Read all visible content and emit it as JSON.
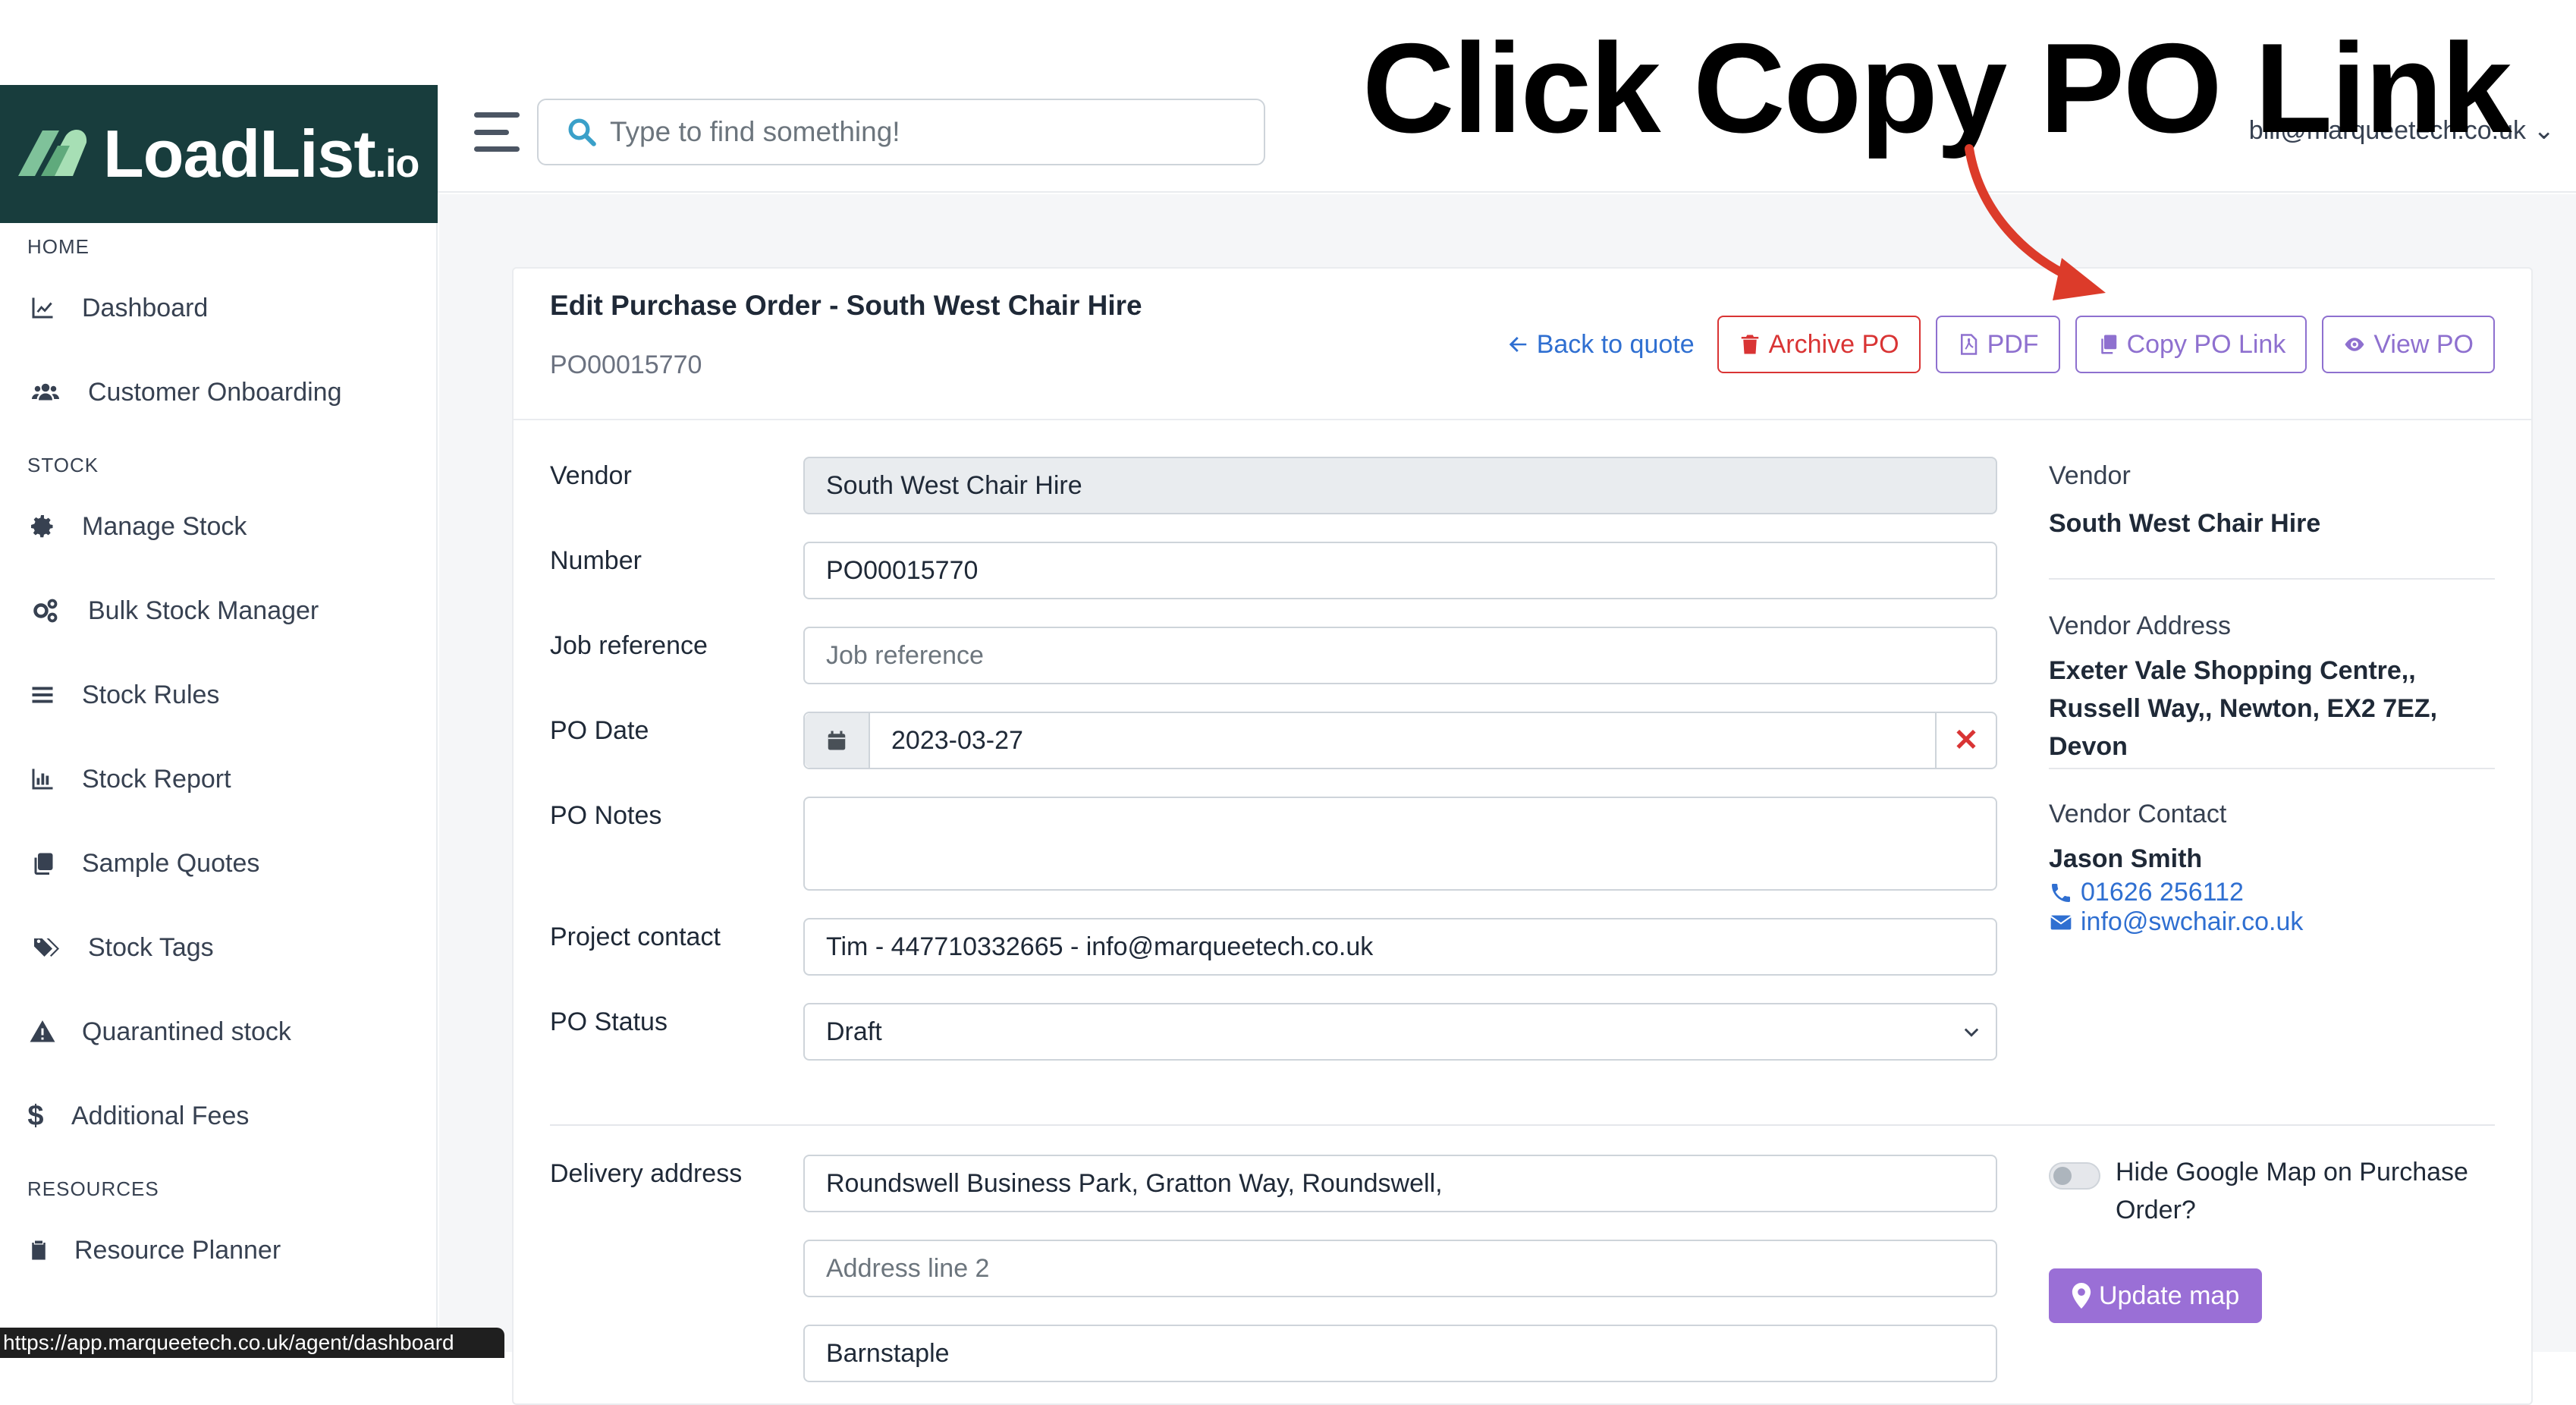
{
  "app": {
    "logo_main": "LoadList",
    "logo_suffix": ".io",
    "user_email": "bill@marqueetech.co.uk"
  },
  "annotation": {
    "text": "Click Copy PO Link"
  },
  "search": {
    "placeholder": "Type to find something!"
  },
  "sidebar": {
    "sections": {
      "home": "HOME",
      "stock": "STOCK",
      "resources": "RESOURCES"
    },
    "items": [
      {
        "label": "Dashboard",
        "icon": "chart-line-icon"
      },
      {
        "label": "Customer Onboarding",
        "icon": "users-icon"
      },
      {
        "label": "Manage Stock",
        "icon": "gear-icon"
      },
      {
        "label": "Bulk Stock Manager",
        "icon": "gears-icon"
      },
      {
        "label": "Stock Rules",
        "icon": "list-icon"
      },
      {
        "label": "Stock Report",
        "icon": "bar-chart-icon"
      },
      {
        "label": "Sample Quotes",
        "icon": "copy-icon"
      },
      {
        "label": "Stock Tags",
        "icon": "tags-icon"
      },
      {
        "label": "Quarantined stock",
        "icon": "warning-icon"
      },
      {
        "label": "Additional Fees",
        "icon": "dollar-icon"
      },
      {
        "label": "Resource Planner",
        "icon": "clipboard-icon"
      }
    ]
  },
  "status_url": "https://app.marqueetech.co.uk/agent/dashboard",
  "page": {
    "title": "Edit Purchase Order - South West Chair Hire",
    "po_number": "PO00015770",
    "actions": {
      "back": "Back to quote",
      "archive": "Archive PO",
      "pdf": "PDF",
      "copy_link": "Copy PO Link",
      "view": "View PO"
    }
  },
  "form": {
    "vendor": {
      "label": "Vendor",
      "value": "South West Chair Hire"
    },
    "number": {
      "label": "Number",
      "value": "PO00015770"
    },
    "job_reference": {
      "label": "Job reference",
      "placeholder": "Job reference"
    },
    "po_date": {
      "label": "PO Date",
      "value": "2023-03-27"
    },
    "po_notes": {
      "label": "PO Notes",
      "value": ""
    },
    "project_contact": {
      "label": "Project contact",
      "value": "Tim - 447710332665 - info@marqueetech.co.uk"
    },
    "po_status": {
      "label": "PO Status",
      "value": "Draft"
    },
    "delivery_address": {
      "label": "Delivery address",
      "line1": "Roundswell Business Park, Gratton Way, Roundswell,",
      "line2_placeholder": "Address line 2",
      "line3": "Barnstaple"
    }
  },
  "vendor_panel": {
    "vendor_label": "Vendor",
    "vendor_name": "South West Chair Hire",
    "address_label": "Vendor Address",
    "address": "Exeter Vale Shopping Centre,, Russell Way,, Newton, EX2 7EZ, Devon",
    "contact_label": "Vendor Contact",
    "contact_name": "Jason Smith",
    "phone": "01626 256112",
    "email": "info@swchair.co.uk"
  },
  "map": {
    "toggle_label": "Hide Google Map on Purchase Order?",
    "update_button": "Update map"
  },
  "colors": {
    "logo_bg": "#183d3d",
    "link_blue": "#2f6fd1",
    "danger_red": "#d93434",
    "purple": "#8e70cf",
    "map_button": "#9a6fd6",
    "arrow_red": "#dc3b2a"
  }
}
